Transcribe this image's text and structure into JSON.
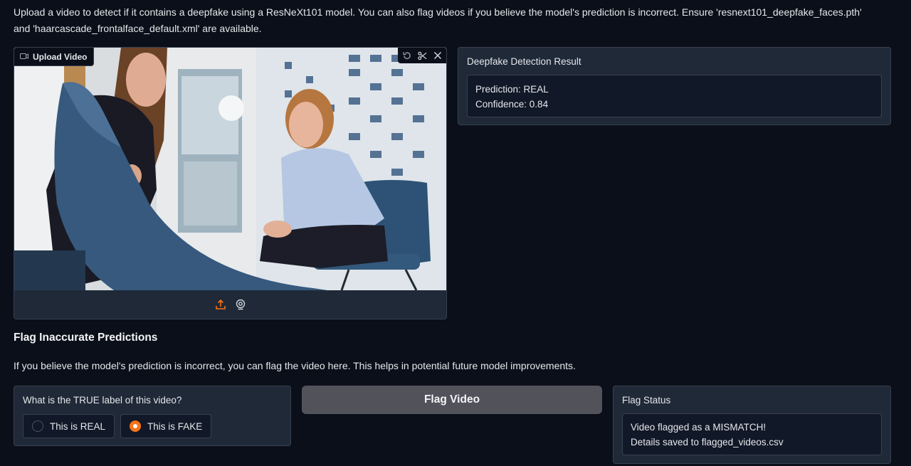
{
  "description": "Upload a video to detect if it contains a deepfake using a ResNeXt101 model. You can also flag videos if you believe the model's prediction is incorrect. Ensure 'resnext101_deepfake_faces.pth' and 'haarcascade_frontalface_default.xml' are available.",
  "video": {
    "label": "Upload Video",
    "tools": [
      "undo-icon",
      "scissors-icon",
      "close-icon"
    ],
    "bar_icons": [
      "upload-icon",
      "webcam-icon"
    ]
  },
  "result": {
    "label": "Deepfake Detection Result",
    "prediction_line": "Prediction: REAL",
    "confidence_line": "Confidence: 0.84"
  },
  "flag": {
    "heading": "Flag Inaccurate Predictions",
    "description": "If you believe the model's prediction is incorrect, you can flag the video here. This helps in potential future model improvements.",
    "question": "What is the TRUE label of this video?",
    "options": [
      {
        "label": "This is REAL",
        "checked": false
      },
      {
        "label": "This is FAKE",
        "checked": true
      }
    ],
    "button_label": "Flag Video"
  },
  "status": {
    "label": "Flag Status",
    "line1": "Video flagged as a MISMATCH!",
    "line2": "Details saved to flagged_videos.csv"
  },
  "colors": {
    "background": "#0b0f19",
    "panel": "#1f2937",
    "accent": "#f97316",
    "button": "#52525b"
  }
}
